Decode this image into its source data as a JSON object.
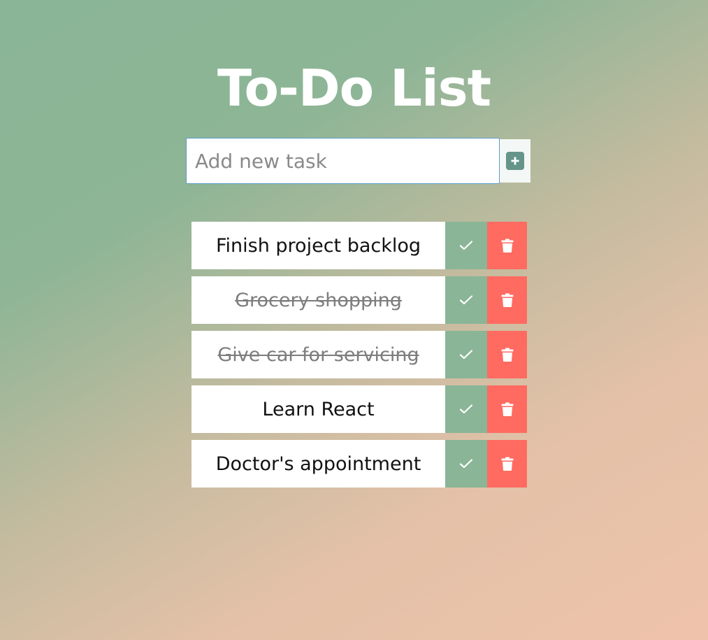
{
  "header": {
    "title": "To-Do List"
  },
  "add_form": {
    "placeholder": "Add new task",
    "value": "",
    "add_icon": "plus-square-icon"
  },
  "tasks": [
    {
      "text": "Finish project backlog",
      "completed": false
    },
    {
      "text": "Grocery shopping",
      "completed": true
    },
    {
      "text": "Give car for servicing",
      "completed": true
    },
    {
      "text": "Learn React",
      "completed": false
    },
    {
      "text": "Doctor's appointment",
      "completed": false
    }
  ],
  "icons": {
    "complete": "check-icon",
    "delete": "trash-icon"
  },
  "colors": {
    "complete_button": "#8ab596",
    "delete_button": "#ff6b61",
    "add_icon": "#64948a",
    "input_border": "#5a9ccc",
    "title": "#ffffff"
  }
}
